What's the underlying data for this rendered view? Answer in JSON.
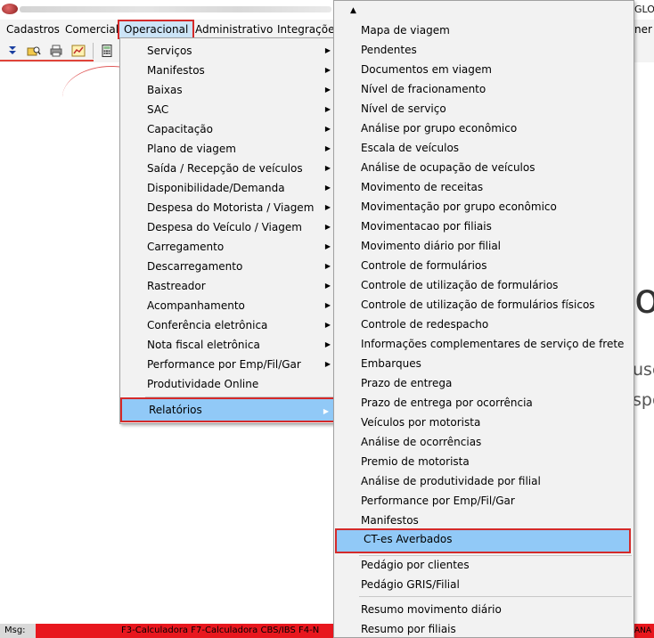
{
  "titlebar": {
    "right_text": "GLO"
  },
  "menubar": {
    "items": [
      {
        "label": "Cadastros"
      },
      {
        "label": "Comercial"
      },
      {
        "label": "Operacional"
      },
      {
        "label": "Administrativo"
      },
      {
        "label": "Integrações"
      }
    ],
    "right_text": "ner"
  },
  "toolbar": {
    "icons": [
      "double-down-arrow-icon",
      "folder-search-icon",
      "printer-icon",
      "chart-icon",
      "calculator-icon"
    ]
  },
  "background": {
    "big_text": "ol",
    "line1": "use",
    "line2": "spo"
  },
  "operacional_menu": {
    "items": [
      {
        "label": "Serviços",
        "submenu": true
      },
      {
        "label": "Manifestos",
        "submenu": true
      },
      {
        "label": "Baixas",
        "submenu": true
      },
      {
        "label": "SAC",
        "submenu": true
      },
      {
        "label": "Capacitação",
        "submenu": true
      },
      {
        "label": "Plano de viagem",
        "submenu": true
      },
      {
        "label": "Saída / Recepção de veículos",
        "submenu": true
      },
      {
        "label": "Disponibilidade/Demanda",
        "submenu": true
      },
      {
        "label": "Despesa do Motorista / Viagem",
        "submenu": true
      },
      {
        "label": "Despesa do Veículo / Viagem",
        "submenu": true
      },
      {
        "label": "Carregamento",
        "submenu": true
      },
      {
        "label": "Descarregamento",
        "submenu": true
      },
      {
        "label": "Rastreador",
        "submenu": true
      },
      {
        "label": "Acompanhamento",
        "submenu": true
      },
      {
        "label": "Conferência eletrônica",
        "submenu": true
      },
      {
        "label": "Nota fiscal eletrônica",
        "submenu": true
      },
      {
        "label": "Performance por Emp/Fil/Gar",
        "submenu": true
      },
      {
        "label": "Produtividade Online",
        "submenu": false
      }
    ],
    "selected": {
      "label": "Relatórios",
      "submenu": true
    }
  },
  "relatorios_menu": {
    "items_group1": [
      "Mapa de viagem",
      "Pendentes",
      "Documentos em viagem",
      "Nível de fracionamento",
      "Nível de serviço",
      "Análise por grupo econômico",
      "Escala de veículos",
      "Análise de ocupação de veículos",
      "Movimento de receitas",
      "Movimentação por grupo econômico",
      "Movimentacao por filiais",
      "Movimento diário por filial",
      "Controle de formulários",
      "Controle de utilização de formulários",
      "Controle de utilização de formulários físicos",
      "Controle de redespacho",
      "Informações complementares de serviço de frete",
      "Embarques",
      "Prazo de entrega",
      "Prazo de entrega por ocorrência",
      "Veículos por motorista",
      "Análise de ocorrências",
      "Premio de motorista",
      "Análise de produtividade por filial",
      "Performance por Emp/Fil/Gar",
      "Manifestos"
    ],
    "selected": "CT-es Averbados",
    "items_group2": [
      "Pedágio por clientes",
      "Pedágio GRIS/Filial"
    ],
    "items_group3": [
      "Resumo movimento diário",
      "Resumo por filiais"
    ]
  },
  "statusbar": {
    "msg_label": "Msg:",
    "text": "F3-Calculadora F7-Calculadora CBS/IBS F4-N",
    "right_text": "ANA"
  },
  "colors": {
    "highlight": "#91c9f7",
    "annotation_red": "#d42a2a",
    "status_red": "#e8171e"
  }
}
